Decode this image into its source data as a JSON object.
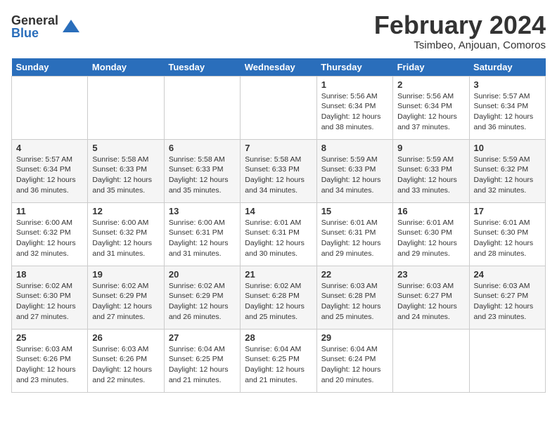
{
  "header": {
    "logo_general": "General",
    "logo_blue": "Blue",
    "month_title": "February 2024",
    "location": "Tsimbeo, Anjouan, Comoros"
  },
  "days_of_week": [
    "Sunday",
    "Monday",
    "Tuesday",
    "Wednesday",
    "Thursday",
    "Friday",
    "Saturday"
  ],
  "weeks": [
    [
      {
        "day": "",
        "info": ""
      },
      {
        "day": "",
        "info": ""
      },
      {
        "day": "",
        "info": ""
      },
      {
        "day": "",
        "info": ""
      },
      {
        "day": "1",
        "info": "Sunrise: 5:56 AM\nSunset: 6:34 PM\nDaylight: 12 hours\nand 38 minutes."
      },
      {
        "day": "2",
        "info": "Sunrise: 5:56 AM\nSunset: 6:34 PM\nDaylight: 12 hours\nand 37 minutes."
      },
      {
        "day": "3",
        "info": "Sunrise: 5:57 AM\nSunset: 6:34 PM\nDaylight: 12 hours\nand 36 minutes."
      }
    ],
    [
      {
        "day": "4",
        "info": "Sunrise: 5:57 AM\nSunset: 6:34 PM\nDaylight: 12 hours\nand 36 minutes."
      },
      {
        "day": "5",
        "info": "Sunrise: 5:58 AM\nSunset: 6:33 PM\nDaylight: 12 hours\nand 35 minutes."
      },
      {
        "day": "6",
        "info": "Sunrise: 5:58 AM\nSunset: 6:33 PM\nDaylight: 12 hours\nand 35 minutes."
      },
      {
        "day": "7",
        "info": "Sunrise: 5:58 AM\nSunset: 6:33 PM\nDaylight: 12 hours\nand 34 minutes."
      },
      {
        "day": "8",
        "info": "Sunrise: 5:59 AM\nSunset: 6:33 PM\nDaylight: 12 hours\nand 34 minutes."
      },
      {
        "day": "9",
        "info": "Sunrise: 5:59 AM\nSunset: 6:33 PM\nDaylight: 12 hours\nand 33 minutes."
      },
      {
        "day": "10",
        "info": "Sunrise: 5:59 AM\nSunset: 6:32 PM\nDaylight: 12 hours\nand 32 minutes."
      }
    ],
    [
      {
        "day": "11",
        "info": "Sunrise: 6:00 AM\nSunset: 6:32 PM\nDaylight: 12 hours\nand 32 minutes."
      },
      {
        "day": "12",
        "info": "Sunrise: 6:00 AM\nSunset: 6:32 PM\nDaylight: 12 hours\nand 31 minutes."
      },
      {
        "day": "13",
        "info": "Sunrise: 6:00 AM\nSunset: 6:31 PM\nDaylight: 12 hours\nand 31 minutes."
      },
      {
        "day": "14",
        "info": "Sunrise: 6:01 AM\nSunset: 6:31 PM\nDaylight: 12 hours\nand 30 minutes."
      },
      {
        "day": "15",
        "info": "Sunrise: 6:01 AM\nSunset: 6:31 PM\nDaylight: 12 hours\nand 29 minutes."
      },
      {
        "day": "16",
        "info": "Sunrise: 6:01 AM\nSunset: 6:30 PM\nDaylight: 12 hours\nand 29 minutes."
      },
      {
        "day": "17",
        "info": "Sunrise: 6:01 AM\nSunset: 6:30 PM\nDaylight: 12 hours\nand 28 minutes."
      }
    ],
    [
      {
        "day": "18",
        "info": "Sunrise: 6:02 AM\nSunset: 6:30 PM\nDaylight: 12 hours\nand 27 minutes."
      },
      {
        "day": "19",
        "info": "Sunrise: 6:02 AM\nSunset: 6:29 PM\nDaylight: 12 hours\nand 27 minutes."
      },
      {
        "day": "20",
        "info": "Sunrise: 6:02 AM\nSunset: 6:29 PM\nDaylight: 12 hours\nand 26 minutes."
      },
      {
        "day": "21",
        "info": "Sunrise: 6:02 AM\nSunset: 6:28 PM\nDaylight: 12 hours\nand 25 minutes."
      },
      {
        "day": "22",
        "info": "Sunrise: 6:03 AM\nSunset: 6:28 PM\nDaylight: 12 hours\nand 25 minutes."
      },
      {
        "day": "23",
        "info": "Sunrise: 6:03 AM\nSunset: 6:27 PM\nDaylight: 12 hours\nand 24 minutes."
      },
      {
        "day": "24",
        "info": "Sunrise: 6:03 AM\nSunset: 6:27 PM\nDaylight: 12 hours\nand 23 minutes."
      }
    ],
    [
      {
        "day": "25",
        "info": "Sunrise: 6:03 AM\nSunset: 6:26 PM\nDaylight: 12 hours\nand 23 minutes."
      },
      {
        "day": "26",
        "info": "Sunrise: 6:03 AM\nSunset: 6:26 PM\nDaylight: 12 hours\nand 22 minutes."
      },
      {
        "day": "27",
        "info": "Sunrise: 6:04 AM\nSunset: 6:25 PM\nDaylight: 12 hours\nand 21 minutes."
      },
      {
        "day": "28",
        "info": "Sunrise: 6:04 AM\nSunset: 6:25 PM\nDaylight: 12 hours\nand 21 minutes."
      },
      {
        "day": "29",
        "info": "Sunrise: 6:04 AM\nSunset: 6:24 PM\nDaylight: 12 hours\nand 20 minutes."
      },
      {
        "day": "",
        "info": ""
      },
      {
        "day": "",
        "info": ""
      }
    ]
  ]
}
